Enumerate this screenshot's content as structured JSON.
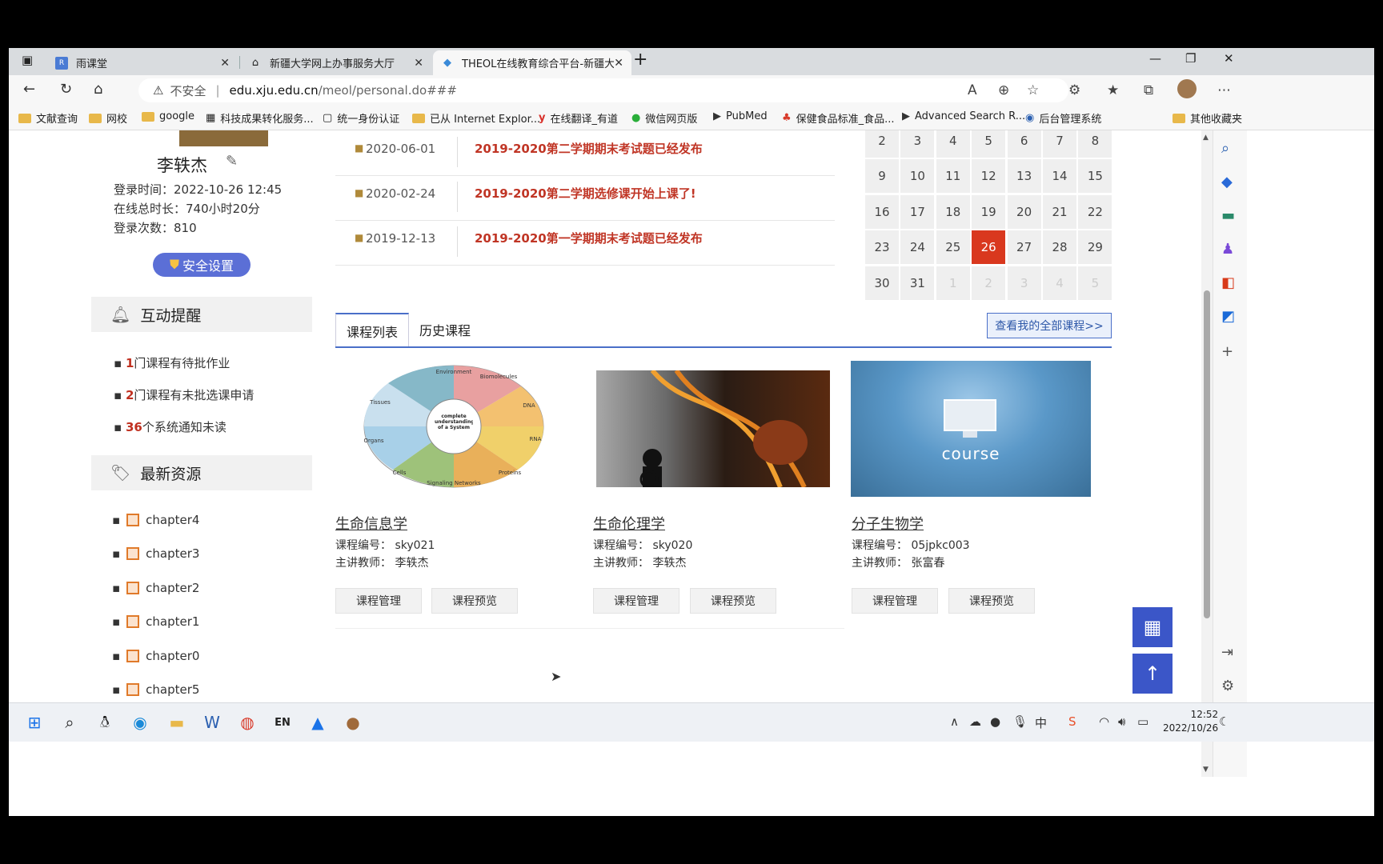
{
  "browser": {
    "tabs": [
      {
        "title": "雨课堂",
        "icon": "rain-classroom-icon"
      },
      {
        "title": "新疆大学网上办事服务大厅",
        "icon": "home-page-icon"
      },
      {
        "title": "THEOL在线教育综合平台-新疆大",
        "icon": "theol-icon"
      }
    ],
    "new_tab": "+",
    "url_warning": "不安全",
    "url_host": "edu.xju.edu.cn",
    "url_path": "/meol/personal.do###"
  },
  "bookmarks": [
    "文献查询",
    "网校",
    "google",
    "科技成果转化服务...",
    "统一身份认证",
    "已从 Internet Explor...",
    "在线翻译_有道",
    "微信网页版",
    "PubMed",
    "保健食品标准_食品...",
    "Advanced Search R...",
    "后台管理系统",
    "其他收藏夹"
  ],
  "profile": {
    "name": "李轶杰",
    "login_time_label": "登录时间：",
    "login_time": "2022-10-26 12:45",
    "online_label": "在线总时长：",
    "online_duration": "740小时20分",
    "login_count_label": "登录次数：",
    "login_count": "810",
    "security_button": "安全设置"
  },
  "interaction": {
    "title": "互动提醒",
    "items": [
      {
        "num": "1",
        "text": "门课程有待批作业"
      },
      {
        "num": "2",
        "text": "门课程有未批选课申请"
      },
      {
        "num": "36",
        "text": "个系统通知未读"
      }
    ]
  },
  "resources": {
    "title": "最新资源",
    "items": [
      "chapter4",
      "chapter3",
      "chapter2",
      "chapter1",
      "chapter0",
      "chapter5"
    ]
  },
  "notices": [
    {
      "date": "2020-06-01",
      "title": "2019-2020第二学期期末考试题已经发布"
    },
    {
      "date": "2020-02-24",
      "title": "2019-2020第二学期选修课开始上课了!"
    },
    {
      "date": "2019-12-13",
      "title": "2019-2020第一学期期末考试题已经发布"
    }
  ],
  "calendar": {
    "rows": [
      [
        "2",
        "3",
        "4",
        "5",
        "6",
        "7",
        "8"
      ],
      [
        "9",
        "10",
        "11",
        "12",
        "13",
        "14",
        "15"
      ],
      [
        "16",
        "17",
        "18",
        "19",
        "20",
        "21",
        "22"
      ],
      [
        "23",
        "24",
        "25",
        "26",
        "27",
        "28",
        "29"
      ],
      [
        "30",
        "31",
        "1",
        "2",
        "3",
        "4",
        "5"
      ]
    ],
    "today": "26"
  },
  "course_tabs": {
    "list": "课程列表",
    "history": "历史课程",
    "view_all": "查看我的全部课程>>"
  },
  "courses": [
    {
      "name": "生命信息学",
      "code_label": "课程编号：",
      "code": "sky021",
      "teacher_label": "主讲教师：",
      "teacher": "李轶杰",
      "manage": "课程管理",
      "preview": "课程预览"
    },
    {
      "name": "生命伦理学",
      "code_label": "课程编号：",
      "code": "sky020",
      "teacher_label": "主讲教师：",
      "teacher": "李轶杰",
      "manage": "课程管理",
      "preview": "课程预览"
    },
    {
      "name": "分子生物学",
      "code_label": "课程编号：",
      "code": "05jpkc003",
      "teacher_label": "主讲教师：",
      "teacher": "张富春",
      "manage": "课程管理",
      "preview": "课程预览"
    }
  ],
  "course3_image_text": "course",
  "diagram_labels": [
    "Environment",
    "Biomolecules",
    "DNA",
    "RNA",
    "Proteins",
    "Signaling Networks",
    "Cells",
    "Organs",
    "Tissues",
    "complete understanding of a System"
  ],
  "taskbar": {
    "time": "12:52",
    "date": "2022/10/26",
    "lang": "EN"
  }
}
